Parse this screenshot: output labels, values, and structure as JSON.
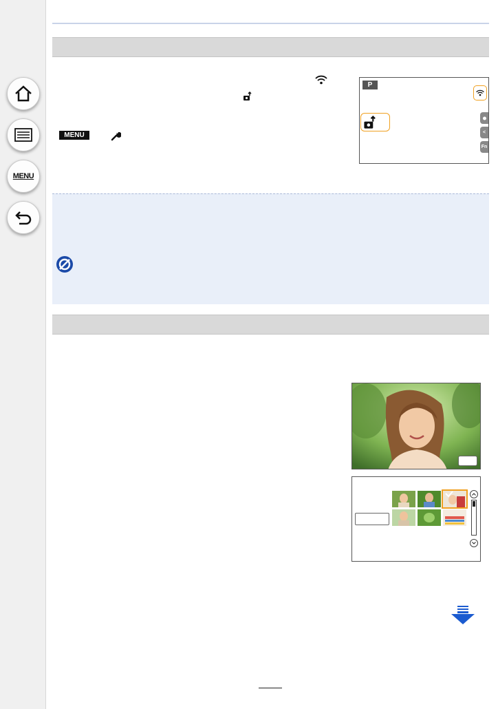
{
  "sidebar": {
    "home_icon": "home-icon",
    "toc_icon": "list-icon",
    "menu_label": "MENU",
    "back_icon": "back-arrow-icon"
  },
  "section1": {
    "menu_badge": "MENU",
    "wrench_icon": "wrench-icon",
    "wifi_icon": "wifi-icon",
    "camera_send_icon": "camera-send-icon"
  },
  "lcd1": {
    "mode": "P",
    "side_tabs": [
      "",
      "<",
      "Fn"
    ]
  },
  "note": {
    "icon": "not-available-icon"
  },
  "colors": {
    "accent_orange": "#f0a020",
    "note_bg": "#e9eff9",
    "section_bar": "#d9d9d9",
    "next_arrow": "#1b5bd0"
  }
}
